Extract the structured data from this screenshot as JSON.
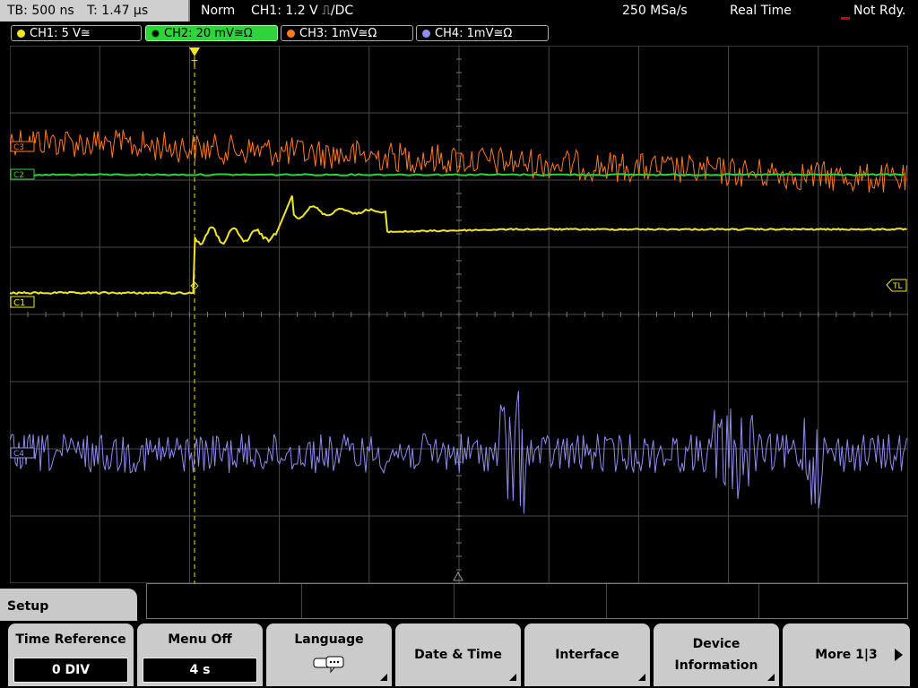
{
  "status_bar": {
    "timebase": "TB: 500 ns",
    "trigger_time": "T: 1.47 µs",
    "trigger_mode": "Norm",
    "trigger_info": "CH1: 1.2 V ⎍/DC",
    "sample_rate": "250 MSa/s",
    "acq_mode": "Real Time",
    "state": "Not Rdy."
  },
  "channels": [
    {
      "label": "CH1: 5 V≅",
      "color": "#f2e61e",
      "active": false
    },
    {
      "label": "CH2: 20 mV≅Ω",
      "color": "#2fd33a",
      "active": true
    },
    {
      "label": "CH3: 1mV≅Ω",
      "color": "#ff7a1a",
      "active": false
    },
    {
      "label": "CH4: 1mV≅Ω",
      "color": "#8f8cf0",
      "active": false
    }
  ],
  "markers": {
    "trigger_level": "TL",
    "ch1": "C1",
    "ch2": "C2",
    "ch3": "C3",
    "ch4": "C4",
    "trigger_pos": "T"
  },
  "menu": {
    "title": "Setup",
    "softkeys": [
      {
        "label": "Time Reference",
        "value": "0 DIV"
      },
      {
        "label": "Menu Off",
        "value": "4 s"
      },
      {
        "label": "Language",
        "icon": "speech-bubble-icon"
      },
      {
        "label": "Date & Time"
      },
      {
        "label": "Interface"
      },
      {
        "label_line1": "Device",
        "label_line2": "Information"
      },
      {
        "label": "More 1|3"
      }
    ]
  },
  "colors": {
    "grid": "#4a4a4a",
    "ch1": "#f2e61e",
    "ch2": "#2fd33a",
    "ch3": "#ff7a1a",
    "ch4": "#8f8cf0"
  }
}
